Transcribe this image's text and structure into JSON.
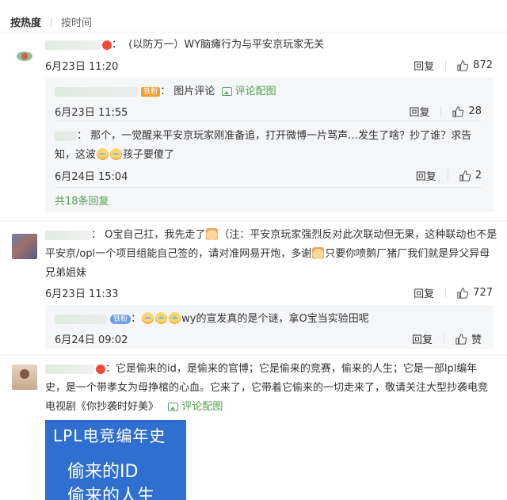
{
  "sort": {
    "hot": "按热度",
    "time": "按时间"
  },
  "actions": {
    "reply": "回复",
    "like": "赞"
  },
  "comments": [
    {
      "text": "(以防万一）WY脑瘫行为与平安京玩家无关",
      "time": "6月23日 11:20",
      "likes": "872",
      "replies": [
        {
          "badge": "铁粉",
          "text": "图片评论",
          "pic_link": "评论配图",
          "time": "6月23日 11:55",
          "likes": "28"
        },
        {
          "text_line1": "那个，一觉醒来平安京玩家刚准备追，打开微博一片骂声…发生了啥？抄了谁？求告",
          "text_line2a": "知，这波",
          "text_line2b": "孩子要傻了",
          "time": "6月24日 15:04",
          "likes": "2"
        }
      ],
      "more_replies": "共18条回复"
    },
    {
      "line1a": "O宝自己扛，我先走了",
      "line1b": "（注：平安京玩家强烈反对此次联动但无果，这种联动也不是",
      "line2a": "平安京/opl一个项目组能自己签的，请对准网易开炮，多谢",
      "line2b": "只要你喷鹅厂猪厂我们就是异父异母",
      "line3": "兄弟姐妹",
      "time": "6月23日 11:33",
      "likes": "727",
      "reply": {
        "badge": "铁粉",
        "text": "wy的宣发真的是个谜，拿O宝当实验田呢",
        "time": "6月24日 09:02"
      }
    },
    {
      "line1": "：它是偷来的id，是偷来的官博；它是偷来的竞赛，偷来的人生；它是一部lpl编年",
      "line2": "史，是一个带孝女为母挣棺的心血。它来了，它带着它偷来的一切走来了，敬请关注大型抄袭电竞",
      "line3": "电视剧《你抄袭时好美》",
      "pic_link": "评论配图",
      "image_text": [
        "LPL电竞编年史",
        "偷来的ID",
        "偷来的人生"
      ]
    }
  ]
}
